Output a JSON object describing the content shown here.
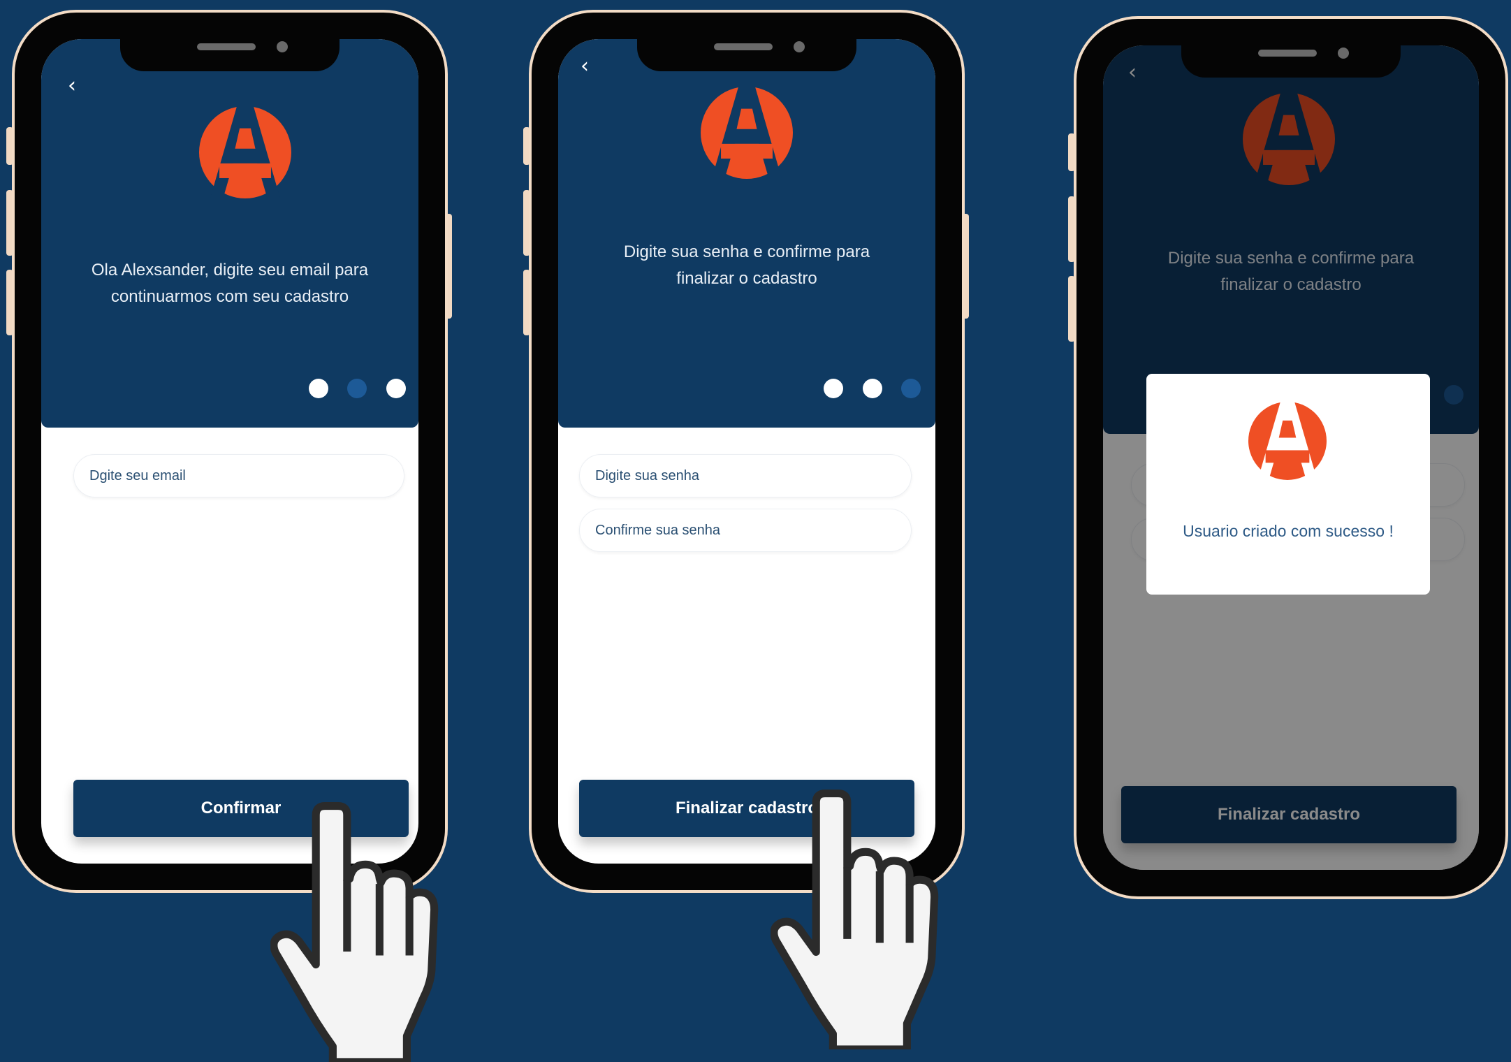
{
  "colors": {
    "background": "#0f3a62",
    "accent_orange": "#ef4f24",
    "phone_bezel": "#f3dcc6",
    "step_active": "#ffffff",
    "step_inactive": "#1d5a97"
  },
  "screens": [
    {
      "back_icon": "chevron-left-icon",
      "logo": "brand-logo-a-icon",
      "prompt": "Ola Alexsander, digite seu email para\ncontinuarmos com seu cadastro",
      "steps": [
        "done",
        "current",
        "pending"
      ],
      "fields": [
        {
          "placeholder": "Dgite seu email",
          "value": ""
        }
      ],
      "button_label": "Confirmar"
    },
    {
      "back_icon": "chevron-left-icon",
      "logo": "brand-logo-a-icon",
      "prompt": "Digite sua senha e confirme para\nfinalizar o cadastro",
      "steps": [
        "done",
        "done",
        "current"
      ],
      "fields": [
        {
          "placeholder": "Digite sua senha",
          "value": ""
        },
        {
          "placeholder": "Confirme sua senha",
          "value": ""
        }
      ],
      "button_label": "Finalizar cadastro"
    },
    {
      "back_icon": "chevron-left-icon",
      "logo": "brand-logo-a-icon",
      "prompt": "Digite sua senha e confirme para\nfinalizar o cadastro",
      "button_label": "Finalizar cadastro",
      "modal": {
        "logo": "brand-logo-a-icon",
        "message": "Usuario criado com sucesso !"
      }
    }
  ],
  "cursor_icon": "pointing-hand-icon"
}
